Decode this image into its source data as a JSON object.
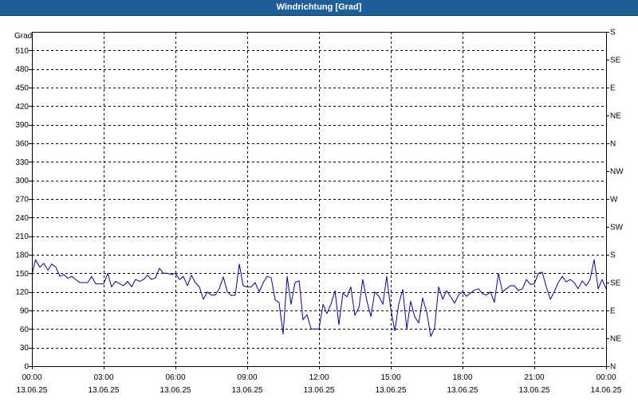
{
  "window": {
    "title": "Windrichtung [Grad]"
  },
  "chart_data": {
    "type": "line",
    "ylabel": "Grad",
    "ylim": [
      0,
      540
    ],
    "yticks": [
      0,
      30,
      60,
      90,
      120,
      150,
      180,
      210,
      240,
      270,
      300,
      330,
      360,
      390,
      420,
      450,
      480,
      510
    ],
    "right_axis": {
      "ticks": [
        {
          "value": 0,
          "label": "N"
        },
        {
          "value": 45,
          "label": "NE"
        },
        {
          "value": 90,
          "label": "E"
        },
        {
          "value": 135,
          "label": "SE"
        },
        {
          "value": 180,
          "label": "S"
        },
        {
          "value": 225,
          "label": "SW"
        },
        {
          "value": 270,
          "label": "W"
        },
        {
          "value": 315,
          "label": "NW"
        },
        {
          "value": 360,
          "label": "N"
        },
        {
          "value": 405,
          "label": "NE"
        },
        {
          "value": 450,
          "label": "E"
        },
        {
          "value": 495,
          "label": "SE"
        },
        {
          "value": 540,
          "label": "S"
        }
      ]
    },
    "xlim": [
      "13.06.25 00:00",
      "14.06.25 00:00"
    ],
    "xticks": [
      {
        "time": "00:00",
        "date": "13.06.25",
        "hour": 0
      },
      {
        "time": "03:00",
        "date": "13.06.25",
        "hour": 3
      },
      {
        "time": "06:00",
        "date": "13.06.25",
        "hour": 6
      },
      {
        "time": "09:00",
        "date": "13.06.25",
        "hour": 9
      },
      {
        "time": "12:00",
        "date": "13.06.25",
        "hour": 12
      },
      {
        "time": "15:00",
        "date": "13.06.25",
        "hour": 15
      },
      {
        "time": "18:00",
        "date": "13.06.25",
        "hour": 18
      },
      {
        "time": "21:00",
        "date": "13.06.25",
        "hour": 21
      },
      {
        "time": "00:00",
        "date": "14.06.25",
        "hour": 24
      }
    ],
    "grid": true,
    "series": [
      {
        "color": "#0000aa",
        "points": [
          [
            0.0,
            147
          ],
          [
            0.15,
            172
          ],
          [
            0.33,
            160
          ],
          [
            0.5,
            166
          ],
          [
            0.67,
            155
          ],
          [
            0.83,
            165
          ],
          [
            1.0,
            160
          ],
          [
            1.17,
            145
          ],
          [
            1.33,
            148
          ],
          [
            1.5,
            142
          ],
          [
            1.67,
            145
          ],
          [
            1.83,
            140
          ],
          [
            2.0,
            135
          ],
          [
            2.17,
            135
          ],
          [
            2.33,
            135
          ],
          [
            2.5,
            145
          ],
          [
            2.67,
            133
          ],
          [
            2.83,
            133
          ],
          [
            3.0,
            133
          ],
          [
            3.17,
            150
          ],
          [
            3.33,
            128
          ],
          [
            3.5,
            137
          ],
          [
            3.67,
            133
          ],
          [
            3.83,
            130
          ],
          [
            4.0,
            137
          ],
          [
            4.17,
            128
          ],
          [
            4.33,
            140
          ],
          [
            4.5,
            137
          ],
          [
            4.67,
            140
          ],
          [
            4.83,
            147
          ],
          [
            5.0,
            140
          ],
          [
            5.17,
            143
          ],
          [
            5.33,
            158
          ],
          [
            5.5,
            150
          ],
          [
            5.67,
            150
          ],
          [
            5.83,
            148
          ],
          [
            6.0,
            150
          ],
          [
            6.17,
            140
          ],
          [
            6.33,
            145
          ],
          [
            6.5,
            130
          ],
          [
            6.67,
            147
          ],
          [
            6.83,
            135
          ],
          [
            7.0,
            128
          ],
          [
            7.17,
            108
          ],
          [
            7.33,
            120
          ],
          [
            7.5,
            115
          ],
          [
            7.67,
            115
          ],
          [
            7.83,
            125
          ],
          [
            8.0,
            144
          ],
          [
            8.17,
            120
          ],
          [
            8.33,
            114
          ],
          [
            8.5,
            115
          ],
          [
            8.67,
            165
          ],
          [
            8.83,
            130
          ],
          [
            9.0,
            128
          ],
          [
            9.17,
            128
          ],
          [
            9.33,
            135
          ],
          [
            9.5,
            120
          ],
          [
            9.67,
            135
          ],
          [
            9.83,
            145
          ],
          [
            10.0,
            143
          ],
          [
            10.17,
            107
          ],
          [
            10.33,
            103
          ],
          [
            10.5,
            52
          ],
          [
            10.67,
            145
          ],
          [
            10.83,
            100
          ],
          [
            11.0,
            135
          ],
          [
            11.17,
            138
          ],
          [
            11.33,
            75
          ],
          [
            11.5,
            83
          ],
          [
            11.67,
            60
          ],
          [
            11.83,
            60
          ],
          [
            12.0,
            60
          ],
          [
            12.17,
            100
          ],
          [
            12.33,
            85
          ],
          [
            12.5,
            100
          ],
          [
            12.67,
            122
          ],
          [
            12.83,
            67
          ],
          [
            13.0,
            118
          ],
          [
            13.17,
            112
          ],
          [
            13.33,
            128
          ],
          [
            13.5,
            82
          ],
          [
            13.67,
            95
          ],
          [
            13.83,
            140
          ],
          [
            14.0,
            106
          ],
          [
            14.17,
            80
          ],
          [
            14.33,
            120
          ],
          [
            14.5,
            113
          ],
          [
            14.67,
            100
          ],
          [
            14.83,
            145
          ],
          [
            15.0,
            92
          ],
          [
            15.17,
            57
          ],
          [
            15.33,
            100
          ],
          [
            15.5,
            124
          ],
          [
            15.67,
            60
          ],
          [
            15.83,
            105
          ],
          [
            16.0,
            80
          ],
          [
            16.17,
            70
          ],
          [
            16.33,
            110
          ],
          [
            16.5,
            88
          ],
          [
            16.67,
            48
          ],
          [
            16.83,
            62
          ],
          [
            17.0,
            128
          ],
          [
            17.17,
            108
          ],
          [
            17.33,
            122
          ],
          [
            17.5,
            112
          ],
          [
            17.67,
            102
          ],
          [
            17.83,
            115
          ],
          [
            18.0,
            120
          ],
          [
            18.17,
            113
          ],
          [
            18.33,
            118
          ],
          [
            18.5,
            123
          ],
          [
            18.67,
            125
          ],
          [
            18.83,
            117
          ],
          [
            19.0,
            115
          ],
          [
            19.17,
            120
          ],
          [
            19.33,
            103
          ],
          [
            19.5,
            150
          ],
          [
            19.67,
            120
          ],
          [
            19.83,
            125
          ],
          [
            20.0,
            130
          ],
          [
            20.17,
            130
          ],
          [
            20.33,
            122
          ],
          [
            20.5,
            125
          ],
          [
            20.67,
            140
          ],
          [
            20.83,
            132
          ],
          [
            21.0,
            133
          ],
          [
            21.17,
            150
          ],
          [
            21.33,
            152
          ],
          [
            21.5,
            128
          ],
          [
            21.67,
            108
          ],
          [
            21.83,
            120
          ],
          [
            22.0,
            135
          ],
          [
            22.17,
            145
          ],
          [
            22.33,
            136
          ],
          [
            22.5,
            140
          ],
          [
            22.67,
            135
          ],
          [
            22.83,
            125
          ],
          [
            23.0,
            138
          ],
          [
            23.17,
            130
          ],
          [
            23.33,
            140
          ],
          [
            23.5,
            172
          ],
          [
            23.67,
            125
          ],
          [
            23.83,
            140
          ],
          [
            24.0,
            125
          ]
        ]
      }
    ]
  }
}
